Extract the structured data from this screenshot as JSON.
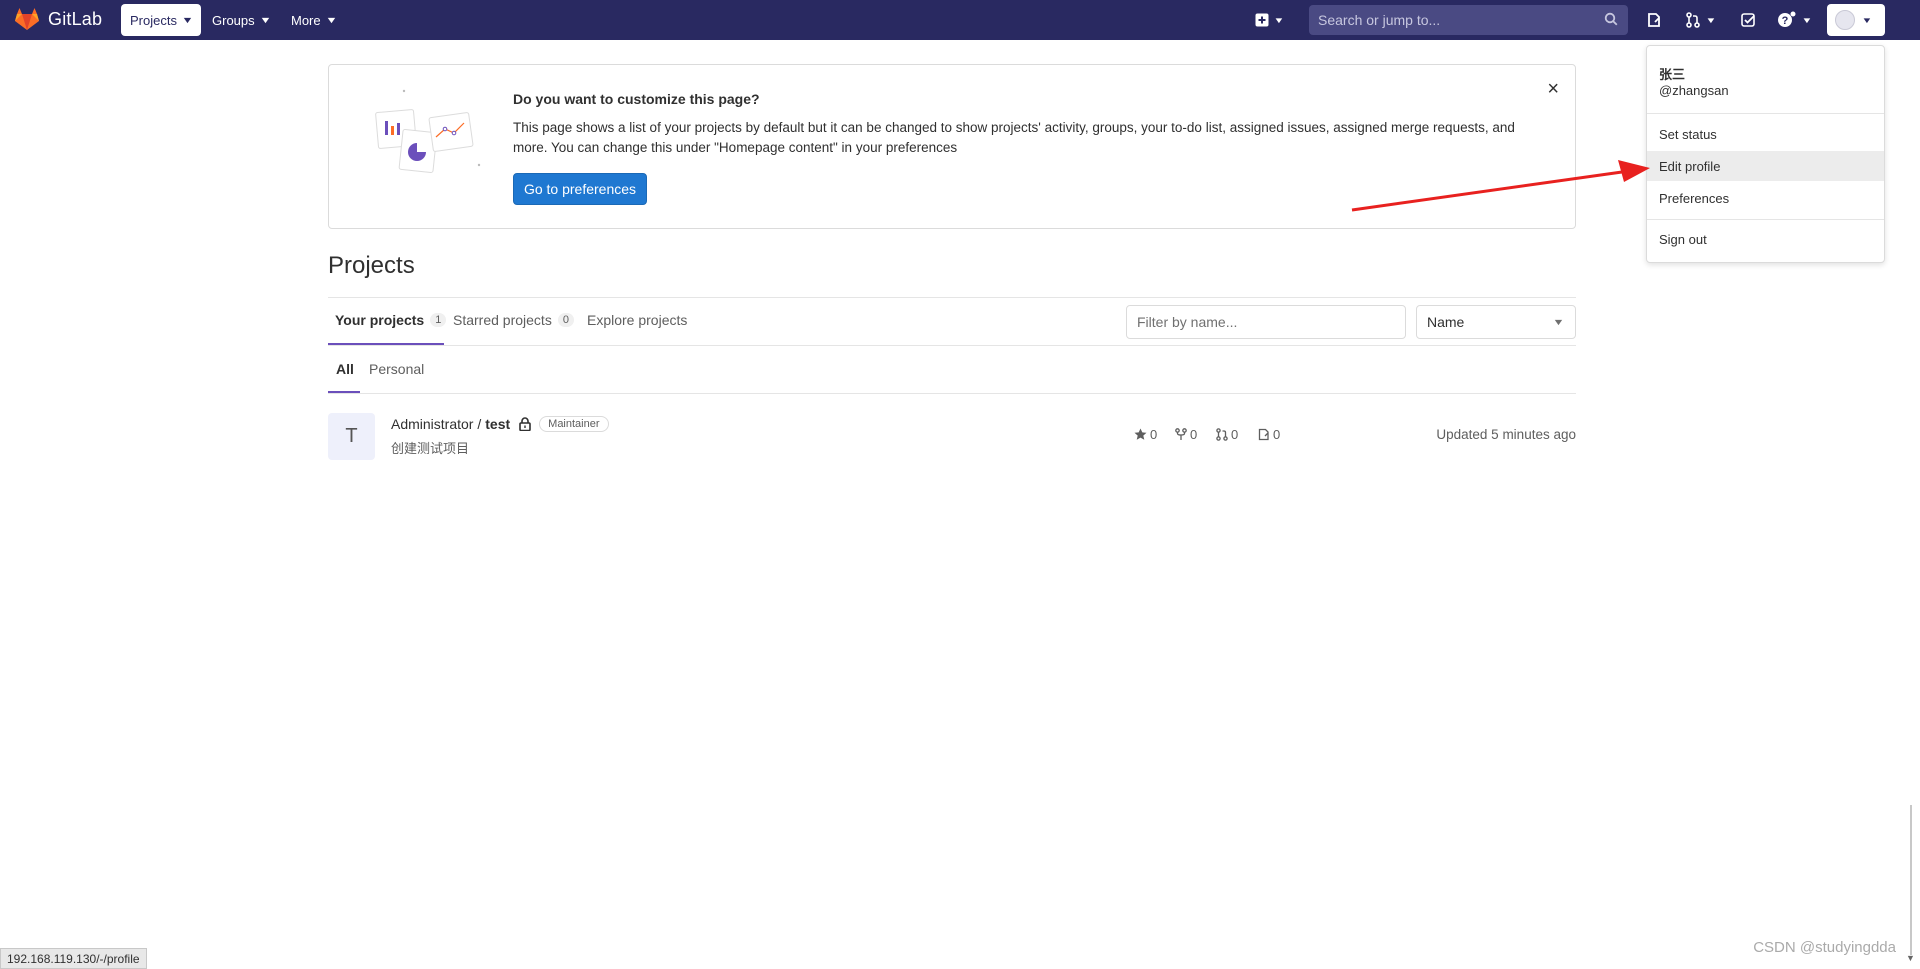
{
  "navbar": {
    "logo_text": "GitLab",
    "projects_label": "Projects",
    "groups_label": "Groups",
    "more_label": "More",
    "search_placeholder": "Search or jump to...",
    "accent": "#292961"
  },
  "banner": {
    "title": "Do you want to customize this page?",
    "text": "This page shows a list of your projects by default but it can be changed to show projects' activity, groups, your to-do list, assigned issues, assigned merge requests, and more. You can change this under \"Homepage content\" in your preferences",
    "button_label": "Go to preferences",
    "close_icon": "×"
  },
  "page": {
    "title": "Projects"
  },
  "tabs": [
    {
      "label": "Your projects",
      "count": "1"
    },
    {
      "label": "Starred projects",
      "count": "0"
    },
    {
      "label": "Explore projects"
    }
  ],
  "filter": {
    "placeholder": "Filter by name...",
    "sort_value": "Name"
  },
  "subtabs": [
    {
      "label": "All"
    },
    {
      "label": "Personal"
    }
  ],
  "project": {
    "avatar_letter": "T",
    "namespace": "Administrator /",
    "name": "test",
    "role": "Maintainer",
    "description": "创建测试项目",
    "stars": "0",
    "forks": "0",
    "merge_requests": "0",
    "issues": "0",
    "updated": "Updated 5 minutes ago"
  },
  "user_menu": {
    "name": "张三",
    "username": "@zhangsan",
    "items": [
      "Set status",
      "Edit profile",
      "Preferences",
      "Sign out"
    ],
    "hovered": "Edit profile"
  },
  "status_bar_url": "192.168.119.130/-/profile",
  "watermark": "CSDN @studyingdda"
}
